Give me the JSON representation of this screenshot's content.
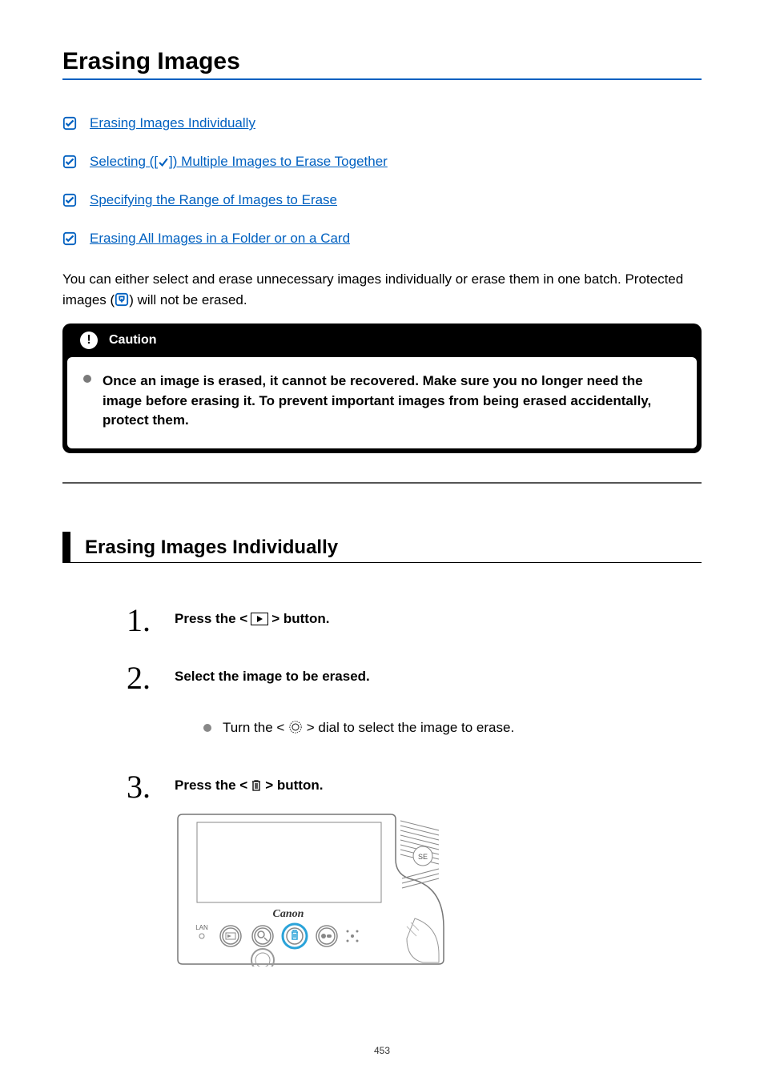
{
  "title": "Erasing Images",
  "toc": [
    {
      "label": "Erasing Images Individually",
      "has_check_icon": false
    },
    {
      "label_pre": "Selecting ([",
      "label_post": "]) Multiple Images to Erase Together",
      "has_check_icon": true
    },
    {
      "label": "Specifying the Range of Images to Erase",
      "has_check_icon": false
    },
    {
      "label": "Erasing All Images in a Folder or on a Card",
      "has_check_icon": false
    }
  ],
  "intro_pre": "You can either select and erase unnecessary images individually or erase them in one batch. Protected images (",
  "intro_post": ") will not be erased.",
  "caution": {
    "heading": "Caution",
    "body": "Once an image is erased, it cannot be recovered. Make sure you no longer need the image before erasing it. To prevent important images from being erased accidentally, protect them."
  },
  "section_heading": "Erasing Images Individually",
  "steps": [
    {
      "pre": "Press the < ",
      "post": " > button.",
      "icon": "playback"
    },
    {
      "title": "Select the image to be erased.",
      "sub_pre": "Turn the < ",
      "sub_post": " > dial to select the image to erase.",
      "sub_icon": "dial"
    },
    {
      "pre": "Press the < ",
      "post": " > button.",
      "icon": "trash"
    }
  ],
  "page_number": "453"
}
